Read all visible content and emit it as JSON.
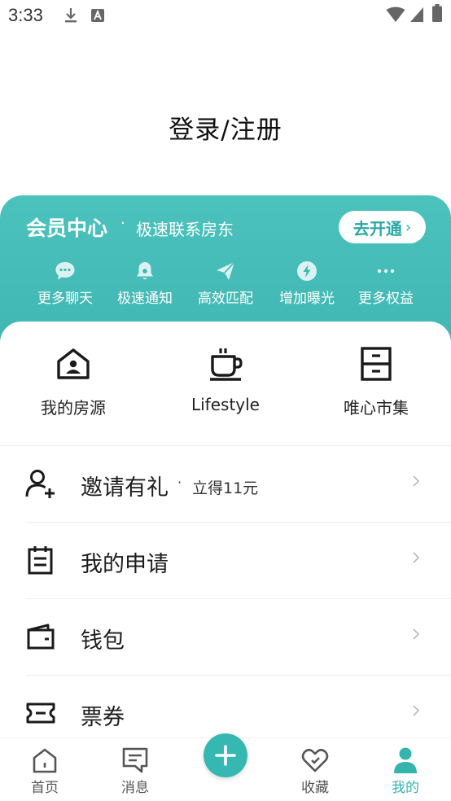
{
  "status_bar": {
    "time": "3:33",
    "icons": [
      "download-icon",
      "a-notification-icon",
      "wifi-icon",
      "signal-icon",
      "battery-icon"
    ]
  },
  "login": {
    "title": "登录/注册"
  },
  "membership": {
    "title": "会员中心",
    "separator": "·",
    "subtitle": "极速联系房东",
    "button_label": "去开通",
    "button_chevron": "›",
    "perks": [
      {
        "icon": "chat-bubble-icon",
        "label": "更多聊天"
      },
      {
        "icon": "bell-icon",
        "label": "极速通知"
      },
      {
        "icon": "paper-plane-icon",
        "label": "高效匹配"
      },
      {
        "icon": "lightning-icon",
        "label": "增加曝光"
      },
      {
        "icon": "more-dots-icon",
        "label": "更多权益"
      }
    ],
    "accent_color": "#3fb9b4"
  },
  "grid": [
    {
      "icon": "house-person-icon",
      "label": "我的房源"
    },
    {
      "icon": "coffee-cup-icon",
      "label": "Lifestyle"
    },
    {
      "icon": "cabinet-icon",
      "label": "唯心市集"
    }
  ],
  "menu": [
    {
      "icon": "add-user-icon",
      "label": "邀请有礼",
      "separator": "·",
      "extra": "立得11元"
    },
    {
      "icon": "clipboard-icon",
      "label": "我的申请"
    },
    {
      "icon": "wallet-icon",
      "label": "钱包"
    },
    {
      "icon": "ticket-icon",
      "label": "票券"
    }
  ],
  "tab_bar": {
    "tabs": [
      {
        "icon": "home-icon",
        "label": "首页"
      },
      {
        "icon": "message-icon",
        "label": "消息"
      },
      {
        "icon": "heart-icon",
        "label": "收藏"
      },
      {
        "icon": "profile-icon",
        "label": "我的"
      }
    ],
    "fab_icon": "plus-icon",
    "active_tab": "我的",
    "active_color": "#35b4ae"
  }
}
